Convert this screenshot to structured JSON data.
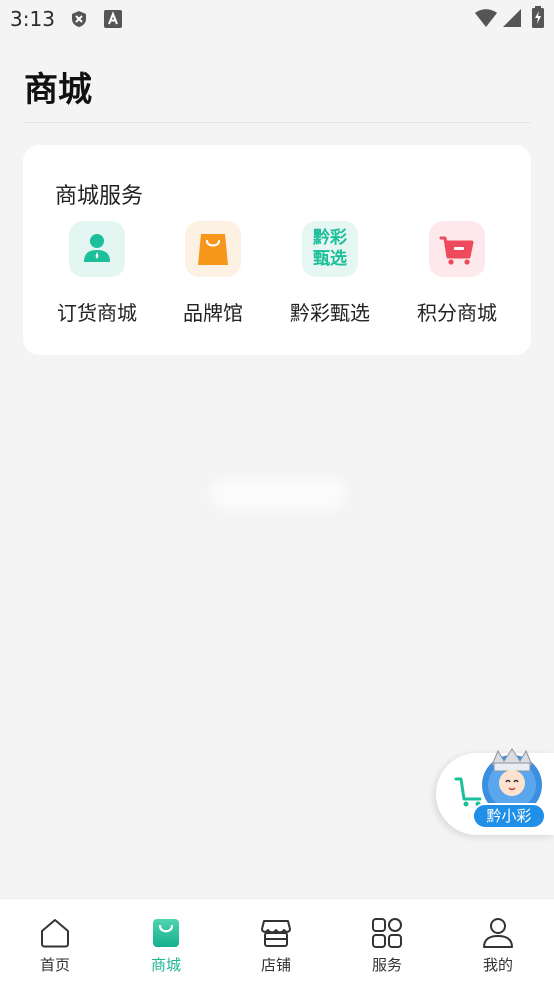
{
  "status_bar": {
    "time": "3:13",
    "icons": [
      "shield-x-icon",
      "font-a-icon",
      "wifi-icon",
      "signal-icon",
      "battery-charging-icon"
    ]
  },
  "page": {
    "title": "商城"
  },
  "service_card": {
    "title": "商城服务",
    "items": [
      {
        "label": "订货商城",
        "icon": "person-icon",
        "color": "#1dbf9b"
      },
      {
        "label": "品牌馆",
        "icon": "shopping-bag-icon",
        "color": "#f6961a"
      },
      {
        "label": "黔彩甄选",
        "icon": "text-logo-icon",
        "icon_text": "黔彩\n甄选",
        "color": "#1dbf9b"
      },
      {
        "label": "积分商城",
        "icon": "shopping-cart-icon",
        "color": "#ef4a5c"
      }
    ]
  },
  "floating_assistant": {
    "label": "黔小彩",
    "icons": [
      "cart-icon",
      "mascot-avatar-icon"
    ],
    "color": "#1f8fe8"
  },
  "bottom_nav": {
    "active_index": 1,
    "active_color": "#1bb894",
    "items": [
      {
        "label": "首页",
        "icon": "home-icon"
      },
      {
        "label": "商城",
        "icon": "shopping-bag-icon"
      },
      {
        "label": "店铺",
        "icon": "store-icon"
      },
      {
        "label": "服务",
        "icon": "grid-icon"
      },
      {
        "label": "我的",
        "icon": "user-icon"
      }
    ]
  }
}
